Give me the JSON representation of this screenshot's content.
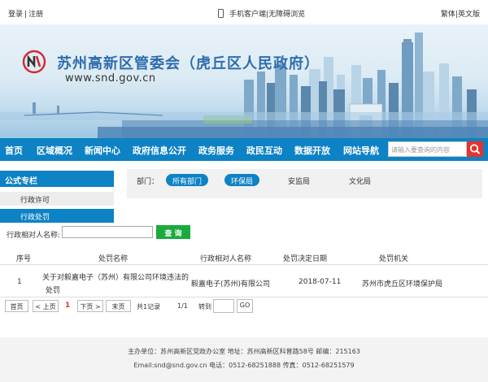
{
  "topbar": {
    "login": "登录",
    "separator": "|",
    "register": "注册",
    "mobile_client": "手机客户端",
    "accessible": "无障碍浏览",
    "traditional": "繁体",
    "english": "英文版"
  },
  "banner": {
    "title": "苏州高新区管委会（虎丘区人民政府）",
    "url": "www.snd.gov.cn"
  },
  "nav": {
    "items": [
      "首页",
      "区域概况",
      "新闻中心",
      "政府信息公开",
      "政务服务",
      "政民互动",
      "数据开放",
      "网站导航"
    ],
    "search_placeholder": "请输入要查询的内容"
  },
  "sidebar": {
    "heading": "公式专栏",
    "items": [
      "行政许可",
      "行政处罚"
    ]
  },
  "departments": {
    "label": "部门：",
    "items": [
      "所有部门",
      "环保局",
      "安监局",
      "文化局"
    ]
  },
  "query": {
    "label": "行政相对人名称:",
    "value": "",
    "button": "查 询"
  },
  "table": {
    "headers": [
      "序号",
      "处罚名称",
      "行政相对人名称",
      "处罚决定日期",
      "处罚机关"
    ],
    "rows": [
      {
        "no": "1",
        "name_line1": "关于对毅嘉电子（苏州）有限公司环境违法的",
        "name_line2": "处罚",
        "party": "毅嘉电子(苏州)有限公司",
        "date": "2018-07-11",
        "authority": "苏州市虎丘区环境保护局"
      }
    ]
  },
  "pagination": {
    "first": "首页",
    "prev": "< 上页",
    "current": "1",
    "next": "下页 >",
    "last": "末页",
    "total": "共1记录",
    "pages": "1/1",
    "goto": "转到",
    "go": "GO"
  },
  "footer": {
    "line1": "主办单位：苏州高新区党政办公室   地址：苏州高新区科普路58号   邮编：215163",
    "line2": "Email:snd@snd.gov.cn   电话：0512-68251888   传真：0512-68251579"
  },
  "colors": {
    "nav_blue": "#0d82c4",
    "search_red": "#e5322d",
    "query_green": "#1aab3f"
  }
}
